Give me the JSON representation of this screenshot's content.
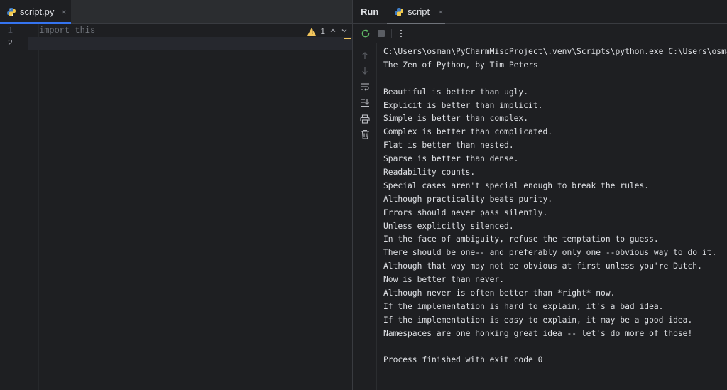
{
  "editor": {
    "tab": {
      "label": "script.py",
      "close": "×",
      "icon": "python-file-icon"
    },
    "line_numbers": [
      "1",
      "2"
    ],
    "lines": [
      "import this",
      ""
    ],
    "inspection": {
      "icon": "warning-icon",
      "count": "1",
      "up": "^",
      "down": "v"
    }
  },
  "run": {
    "title": "Run",
    "tab": {
      "label": "script",
      "close": "×",
      "icon": "python-file-icon"
    },
    "toolbar": [
      "rerun-icon",
      "stop-icon",
      "more-options-icon"
    ],
    "side_actions": [
      "scroll-up-icon",
      "scroll-down-icon",
      "soft-wrap-icon",
      "scroll-to-end-icon",
      "print-icon",
      "clear-all-icon"
    ],
    "console_lines": [
      "C:\\Users\\osman\\PyCharmMiscProject\\.venv\\Scripts\\python.exe C:\\Users\\osman",
      "The Zen of Python, by Tim Peters",
      "",
      "Beautiful is better than ugly.",
      "Explicit is better than implicit.",
      "Simple is better than complex.",
      "Complex is better than complicated.",
      "Flat is better than nested.",
      "Sparse is better than dense.",
      "Readability counts.",
      "Special cases aren't special enough to break the rules.",
      "Although practicality beats purity.",
      "Errors should never pass silently.",
      "Unless explicitly silenced.",
      "In the face of ambiguity, refuse the temptation to guess.",
      "There should be one-- and preferably only one --obvious way to do it.",
      "Although that way may not be obvious at first unless you're Dutch.",
      "Now is better than never.",
      "Although never is often better than *right* now.",
      "If the implementation is hard to explain, it's a bad idea.",
      "If the implementation is easy to explain, it may be a good idea.",
      "Namespaces are one honking great idea -- let's do more of those!",
      "",
      "Process finished with exit code 0"
    ]
  },
  "colors": {
    "accent": "#3574f0",
    "warning": "#f2c55c",
    "background": "#1e1f22",
    "rerun": "#5fb865"
  }
}
